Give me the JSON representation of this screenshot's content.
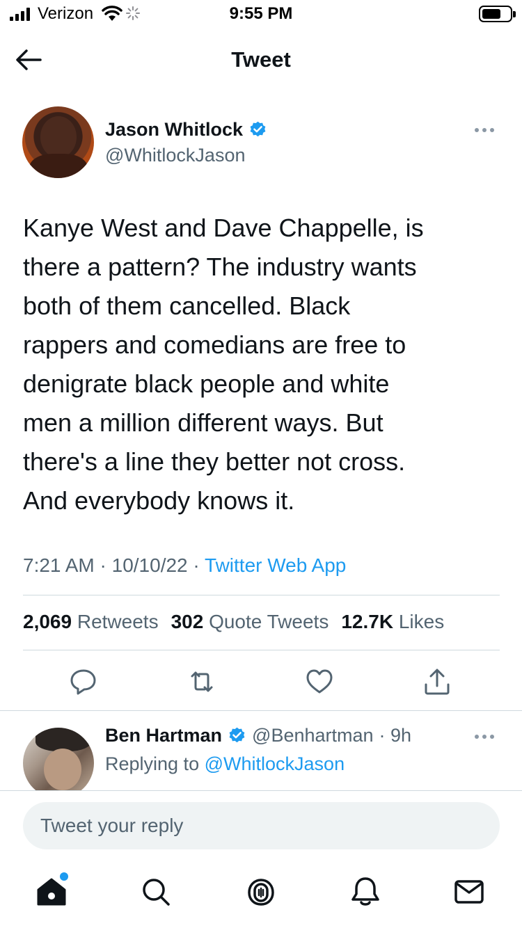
{
  "status_bar": {
    "carrier": "Verizon",
    "time": "9:55 PM"
  },
  "header": {
    "title": "Tweet"
  },
  "tweet": {
    "author_name": "Jason Whitlock",
    "author_handle": "@WhitlockJason",
    "text": "Kanye West and Dave Chappelle, is\nthere a pattern? The  industry wants\nboth of them cancelled. Black\nrappers and comedians are free to\ndenigrate black people and white\nmen a million different ways. But\nthere's a line they better not cross.\nAnd everybody knows it.",
    "time": "7:21 AM",
    "date": "10/10/22",
    "separator": "·",
    "source": "Twitter Web App",
    "stats": {
      "retweets_count": "2,069",
      "retweets_label": "Retweets",
      "quotes_count": "302",
      "quotes_label": "Quote Tweets",
      "likes_count": "12.7K",
      "likes_label": "Likes"
    }
  },
  "reply": {
    "author_name": "Ben Hartman",
    "author_handle": "@Benhartman",
    "time_ago": "· 9h",
    "replying_label": "Replying to",
    "replying_to": "@WhitlockJason"
  },
  "reply_box": {
    "placeholder": "Tweet your reply"
  },
  "icons": {
    "verified_color": "#1d9bf0",
    "accent": "#1d9bf0"
  }
}
